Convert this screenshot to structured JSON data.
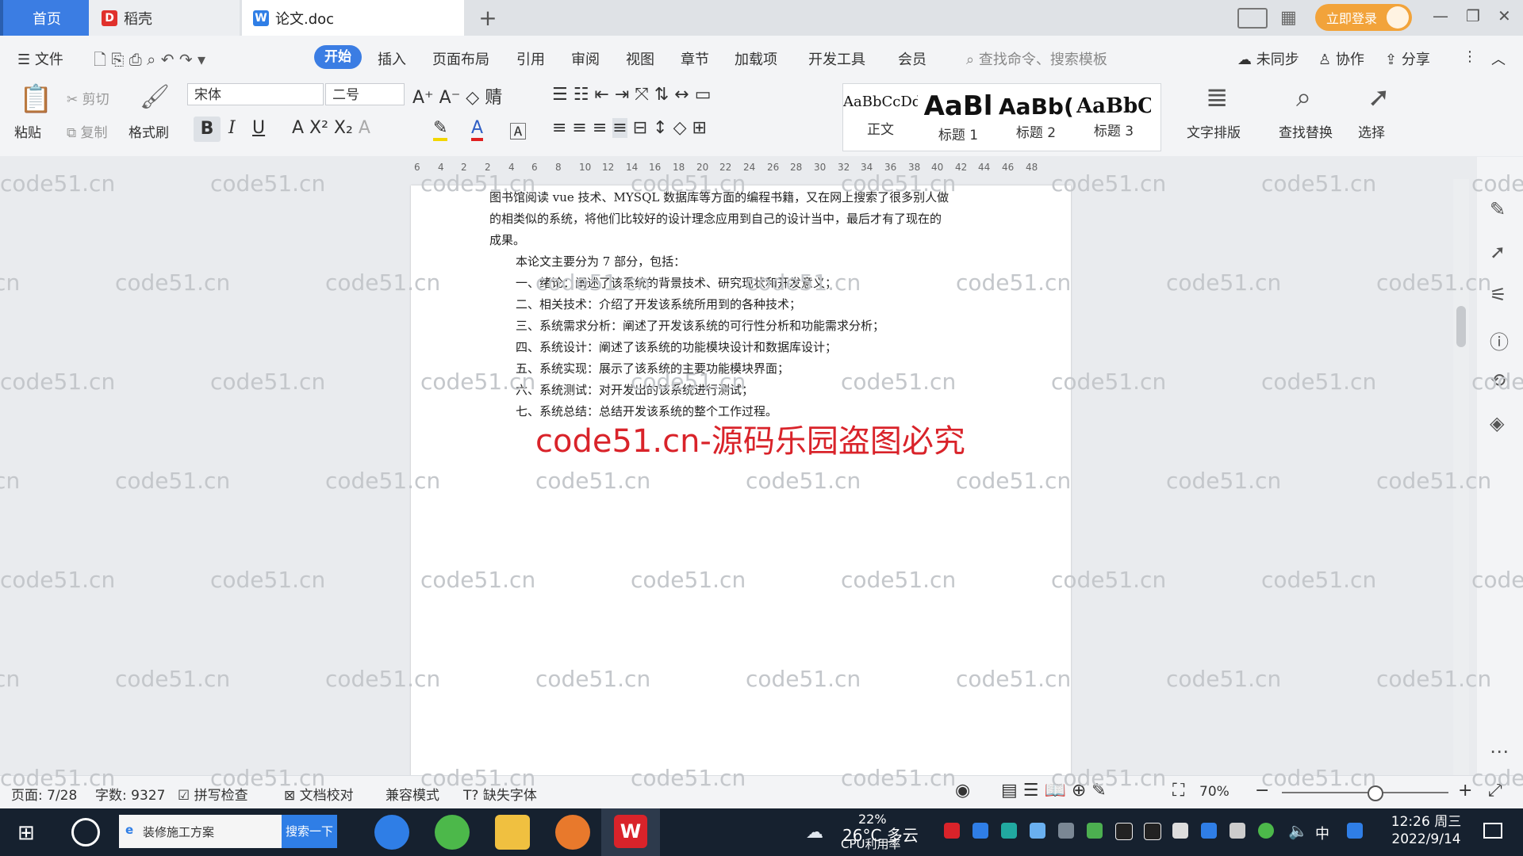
{
  "titlebar": {
    "tabs": [
      {
        "label": "首页"
      },
      {
        "label": "稻壳"
      },
      {
        "label": "论文.doc"
      }
    ],
    "login_label": "立即登录"
  },
  "menubar": {
    "file_label": "文件",
    "items": [
      "开始",
      "插入",
      "页面布局",
      "引用",
      "审阅",
      "视图",
      "章节",
      "加载项",
      "开发工具",
      "会员"
    ],
    "search_cmd": "查找命令、搜索模板",
    "sync_label": "未同步",
    "collab_label": "协作",
    "share_label": "分享"
  },
  "ribbon": {
    "paste": "粘贴",
    "cut": "剪切",
    "copy": "复制",
    "format_painter": "格式刷",
    "font_name": "宋体",
    "font_size": "二号",
    "styles": [
      {
        "preview": "AaBbCcDd",
        "label": "正文"
      },
      {
        "preview": "AaBl",
        "label": "标题 1"
      },
      {
        "preview": "AaBb(",
        "label": "标题 2"
      },
      {
        "preview": "AaBbC",
        "label": "标题 3"
      }
    ],
    "text_layout": "文字排版",
    "find_replace": "查找替换",
    "select": "选择"
  },
  "ruler": {
    "ticks": [
      "6",
      "4",
      "2",
      "2",
      "4",
      "6",
      "8",
      "10",
      "12",
      "14",
      "16",
      "18",
      "20",
      "22",
      "24",
      "26",
      "28",
      "30",
      "32",
      "34",
      "36",
      "38",
      "40",
      "42",
      "44",
      "46",
      "48"
    ]
  },
  "document": {
    "lines": [
      "图书馆阅读 vue 技术、MYSQL 数据库等方面的编程书籍，又在网上搜索了很多别人做",
      "的相类似的系统，将他们比较好的设计理念应用到自己的设计当中，最后才有了现在的",
      "成果。",
      "本论文主要分为 7 部分，包括：",
      "一、绪论：阐述了该系统的背景技术、研究现状和开发意义；",
      "二、相关技术：介绍了开发该系统所用到的各种技术；",
      "三、系统需求分析：阐述了开发该系统的可行性分析和功能需求分析；",
      "四、系统设计：阐述了该系统的功能模块设计和数据库设计；",
      "五、系统实现：展示了该系统的主要功能模块界面；",
      "六、系统测试：对开发出的该系统进行测试；",
      "七、系统总结：总结开发该系统的整个工作过程。"
    ],
    "red_watermark": "code51.cn-源码乐园盗图必究"
  },
  "watermark_text": "code51.cn",
  "statusbar": {
    "page": "页面: 7/28",
    "words": "字数: 9327",
    "spell": "拼写检查",
    "proof": "文档校对",
    "compat": "兼容模式",
    "missing_font": "缺失字体",
    "zoom": "70%",
    "zoom_level": 0.55
  },
  "taskbar": {
    "search_text": "装修施工方案",
    "search_btn": "搜索一下",
    "weather": "26°C 多云",
    "cpu_pct": "22%",
    "cpu_label": "CPU利用率",
    "ime": "中",
    "time": "12:26 周三",
    "date": "2022/9/14"
  },
  "colors": {
    "accent": "#3b7de3",
    "login": "#f2a33a",
    "red_watermark": "#d9232a"
  }
}
